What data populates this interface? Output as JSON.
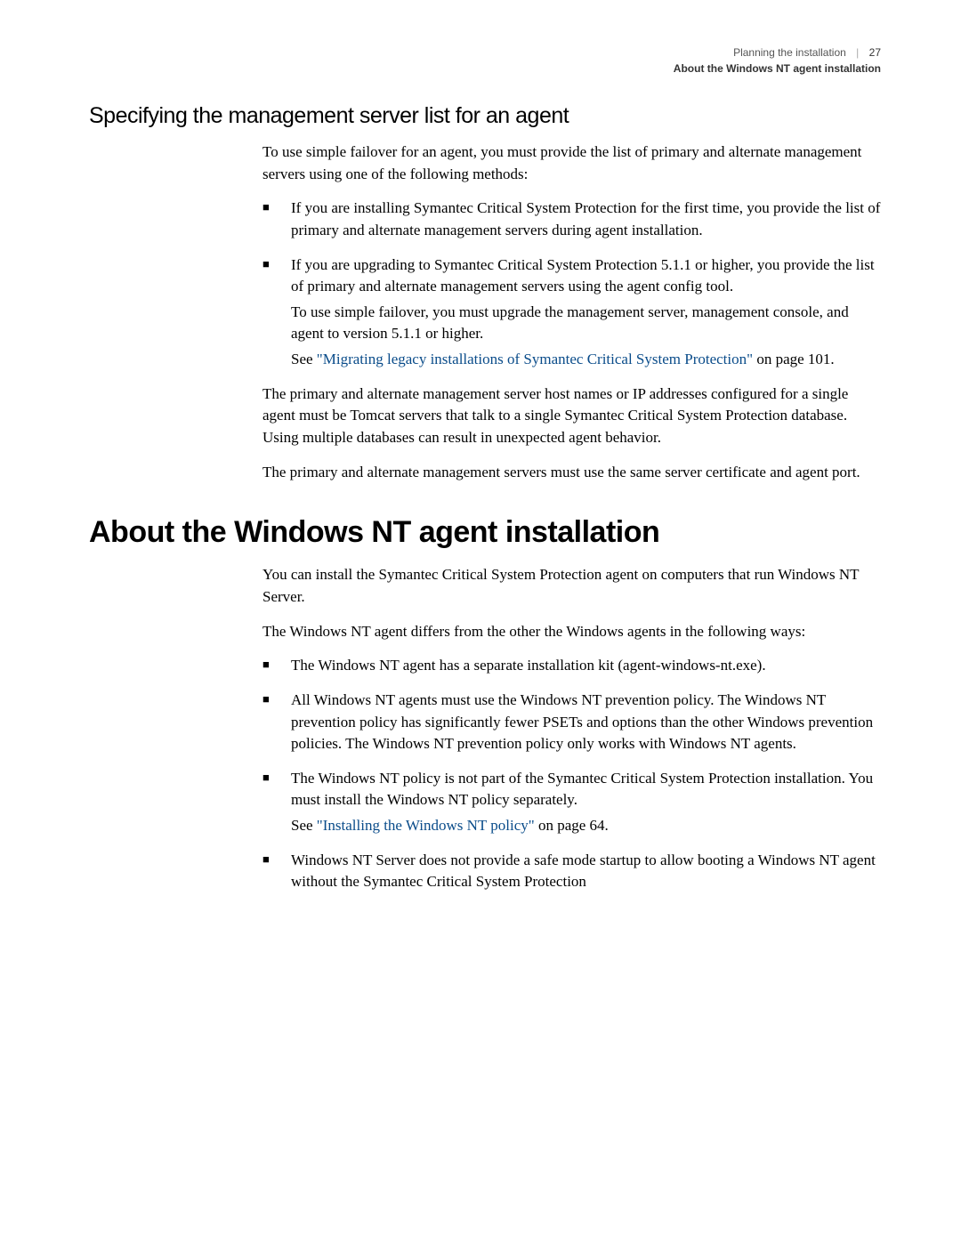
{
  "header": {
    "chapter": "Planning the installation",
    "section": "About the Windows NT agent installation",
    "page_number": "27"
  },
  "section1": {
    "heading": "Specifying the management server list for an agent",
    "para1": "To use simple failover for an agent, you must provide the list of primary and alternate management servers using one of the following methods:",
    "bullet1": "If you are installing Symantec Critical System Protection for the first time, you provide the list of primary and alternate management servers during agent installation.",
    "bullet2_a": "If you are upgrading to Symantec Critical System Protection 5.1.1 or higher, you provide the list of primary and alternate management servers using the agent config tool.",
    "bullet2_b": "To use simple failover, you must upgrade the management server, management console, and agent to version 5.1.1 or higher.",
    "bullet2_see_pre": "See ",
    "bullet2_link": "\"Migrating legacy installations of Symantec Critical System Protection\"",
    "bullet2_see_post": " on page 101.",
    "para2": "The primary and alternate management server host names or IP addresses configured for a single agent must be Tomcat servers that talk to a single Symantec Critical System Protection database. Using multiple databases can result in unexpected agent behavior.",
    "para3": "The primary and alternate management servers must use the same server certificate and agent port."
  },
  "section2": {
    "heading": "About the Windows NT agent installation",
    "para1": "You can install the Symantec Critical System Protection agent on computers that run Windows NT Server.",
    "para2": "The Windows NT agent differs from the other the Windows agents in the following ways:",
    "bullet1": "The Windows NT agent has a separate installation kit (agent-windows-nt.exe).",
    "bullet2": "All Windows NT agents must use the Windows NT prevention policy. The Windows NT prevention policy has significantly fewer PSETs and options than the other Windows prevention policies. The Windows NT prevention policy only works with Windows NT agents.",
    "bullet3_a": "The Windows NT policy is not part of the Symantec Critical System Protection installation. You must install the Windows NT policy separately.",
    "bullet3_see_pre": "See ",
    "bullet3_link": "\"Installing the Windows NT policy\"",
    "bullet3_see_post": " on page 64.",
    "bullet4": "Windows NT Server does not provide a safe mode startup to allow booting a Windows NT agent without the Symantec Critical System Protection"
  }
}
